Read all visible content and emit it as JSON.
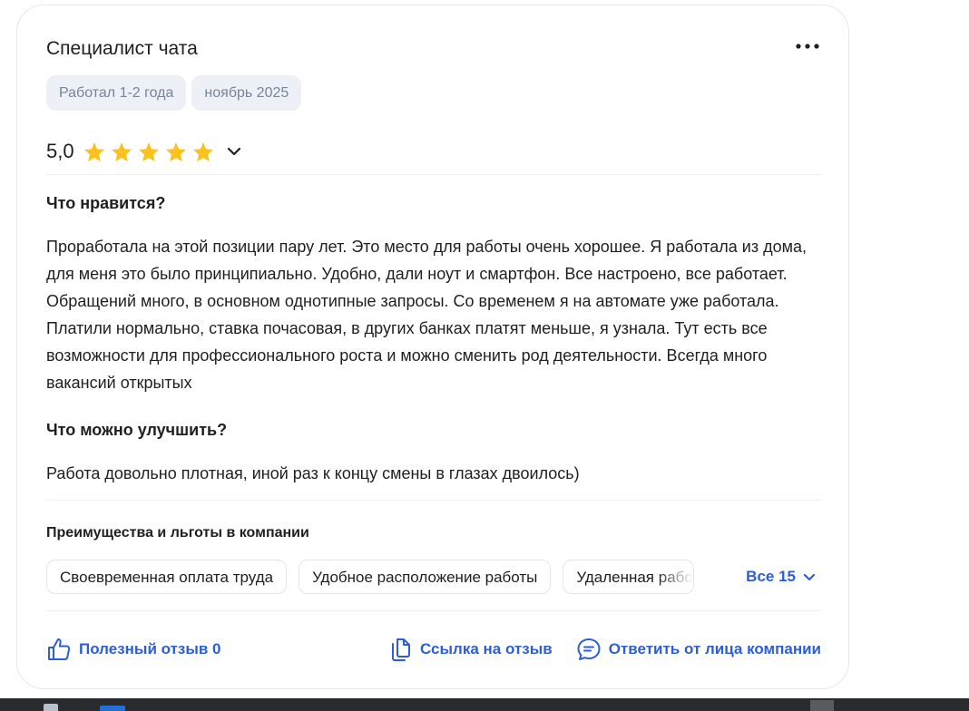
{
  "review": {
    "title": "Специалист чата",
    "tags": [
      "Работал 1-2 года",
      "ноябрь 2025"
    ],
    "rating": "5,0",
    "stars": 5,
    "star_color": "#fcc21b",
    "likes_heading": "Что нравится?",
    "likes_text": "Проработала на этой позиции пару лет. Это место для работы очень хорошее. Я работала из дома, для меня это было принципиально. Удобно, дали ноут и смартфон. Все настроено, все работает. Обращений много, в основном однотипные запросы. Со временем я на автомате уже работала. Платили нормально, ставка почасовая, в других банках платят меньше, я узнала. Тут есть все возможности для профессионального роста и можно сменить род деятельности. Всегда много вакансий открытых",
    "improve_heading": "Что можно улучшить?",
    "improve_text": "Работа довольно плотная, иной раз к концу смены в глазах двоилось)"
  },
  "perks": {
    "title": "Преимущества и льготы в компании",
    "items": [
      "Своевременная оплата труда",
      "Удобное расположение работы",
      "Удаленная работа"
    ],
    "all_label": "Все 15"
  },
  "actions": {
    "helpful": "Полезный отзыв 0",
    "link": "Ссылка на отзыв",
    "reply": "Ответить от лица компании"
  },
  "colors": {
    "accent": "#2d5dd8",
    "tag_bg": "#edf0f6",
    "tag_text": "#7a8494"
  },
  "icons": [
    "more-icon",
    "star-icon",
    "chevron-down-icon",
    "thumbs-up-icon",
    "copy-link-icon",
    "chat-bubble-icon"
  ]
}
